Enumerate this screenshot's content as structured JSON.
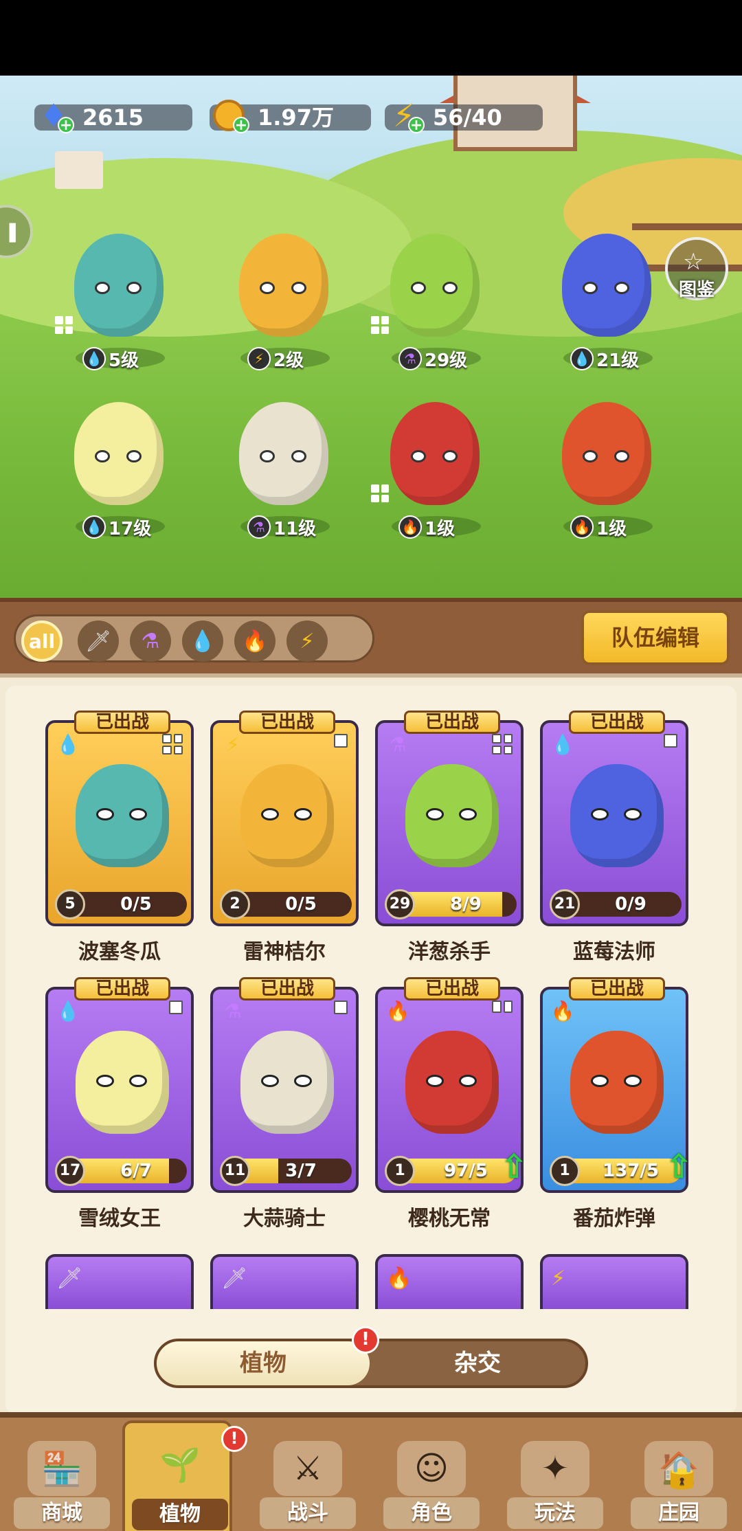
{
  "resources": {
    "gems": "2615",
    "coins": "1.97万",
    "energy": "56/40"
  },
  "atlas_label": "图鉴",
  "team": [
    {
      "level": "5级",
      "element": "water"
    },
    {
      "level": "2级",
      "element": "lightning"
    },
    {
      "level": "29级",
      "element": "poison"
    },
    {
      "level": "21级",
      "element": "water"
    },
    {
      "level": "17级",
      "element": "water"
    },
    {
      "level": "11级",
      "element": "poison"
    },
    {
      "level": "1级",
      "element": "fire"
    },
    {
      "level": "1级",
      "element": "fire"
    }
  ],
  "filters": {
    "all_label": "all",
    "items": [
      "all",
      "sword",
      "poison",
      "water",
      "fire",
      "lightning"
    ]
  },
  "team_edit_label": "队伍编辑",
  "deployed_label": "已出战",
  "cards": [
    {
      "name": "波塞冬瓜",
      "level": "5",
      "progress": "0/5",
      "fraction": 0.0,
      "rarity": "gold",
      "element": "water",
      "deployed": true
    },
    {
      "name": "雷神桔尔",
      "level": "2",
      "progress": "0/5",
      "fraction": 0.0,
      "rarity": "gold",
      "element": "lightning",
      "deployed": true
    },
    {
      "name": "洋葱杀手",
      "level": "29",
      "progress": "8/9",
      "fraction": 0.89,
      "rarity": "purple",
      "element": "poison",
      "deployed": true
    },
    {
      "name": "蓝莓法师",
      "level": "21",
      "progress": "0/9",
      "fraction": 0.0,
      "rarity": "purple",
      "element": "water",
      "deployed": true
    },
    {
      "name": "雪绒女王",
      "level": "17",
      "progress": "6/7",
      "fraction": 0.86,
      "rarity": "purple",
      "element": "water",
      "deployed": true
    },
    {
      "name": "大蒜骑士",
      "level": "11",
      "progress": "3/7",
      "fraction": 0.43,
      "rarity": "purple",
      "element": "poison",
      "deployed": true
    },
    {
      "name": "樱桃无常",
      "level": "1",
      "progress": "97/5",
      "fraction": 1.0,
      "rarity": "purple",
      "element": "fire",
      "deployed": true,
      "upgradable": true
    },
    {
      "name": "番茄炸弹",
      "level": "1",
      "progress": "137/5",
      "fraction": 1.0,
      "rarity": "blue",
      "element": "fire",
      "deployed": true,
      "upgradable": true
    }
  ],
  "toggle": {
    "plants": "植物",
    "hybrid": "杂交",
    "badge": "!"
  },
  "nav": [
    {
      "label": "商城",
      "icon": "shop-icon"
    },
    {
      "label": "植物",
      "icon": "plant-icon",
      "active": true,
      "badge": "!"
    },
    {
      "label": "战斗",
      "icon": "battle-icon"
    },
    {
      "label": "角色",
      "icon": "character-icon"
    },
    {
      "label": "玩法",
      "icon": "gameplay-icon"
    },
    {
      "label": "庄园",
      "icon": "manor-icon",
      "locked": true
    }
  ],
  "colors": {
    "gold_card": "#f2b93a",
    "purple_card": "#9a5ee0",
    "blue_card": "#4aa3ea",
    "accent": "#f2c44c"
  }
}
